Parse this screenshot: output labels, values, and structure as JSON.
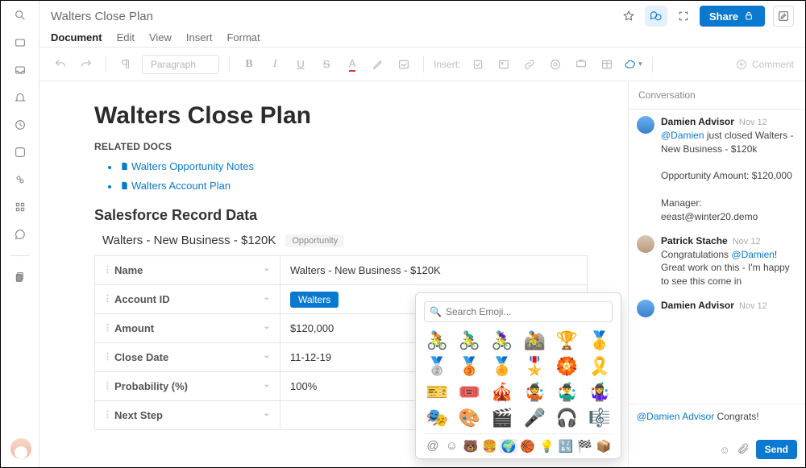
{
  "header": {
    "title": "Walters Close Plan",
    "share_label": "Share",
    "menu": {
      "document": "Document",
      "edit": "Edit",
      "view": "View",
      "insert": "Insert",
      "format": "Format"
    }
  },
  "toolbar": {
    "paragraph_label": "Paragraph",
    "insert_label": "Insert:",
    "comment_label": "Comment"
  },
  "document": {
    "heading": "Walters Close Plan",
    "related_label": "RELATED DOCS",
    "related_docs": [
      {
        "label": "Walters Opportunity Notes"
      },
      {
        "label": "Walters  Account Plan"
      }
    ],
    "salesforce_heading": "Salesforce Record Data",
    "record_title": "Walters - New Business - $120K",
    "record_badge": "Opportunity",
    "table": {
      "rows": [
        {
          "key": "Name",
          "value": "Walters - New Business - $120K",
          "pill": false
        },
        {
          "key": "Account ID",
          "value": "Walters",
          "pill": true
        },
        {
          "key": "Amount",
          "value": "$120,000",
          "pill": false
        },
        {
          "key": "Close Date",
          "value": "11-12-19",
          "pill": false
        },
        {
          "key": "Probability (%)",
          "value": "100%",
          "pill": false
        },
        {
          "key": "Next Step",
          "value": "",
          "pill": false
        }
      ]
    }
  },
  "conversation": {
    "header": "Conversation",
    "messages": [
      {
        "author": "Damien Advisor",
        "date": "Nov 12",
        "avatar": "blue",
        "body": "<span class='mention'>@Damien</span> just closed Walters - New Business - $120k<br><br>Opportunity Amount: $120,000<br><br>Manager: eeast@winter20.demo"
      },
      {
        "author": "Patrick Stache",
        "date": "Nov 12",
        "avatar": "pat",
        "body": "Congratulations <span class='mention'>@Damien</span>! Great work on this - I'm happy to see this come in"
      },
      {
        "author": "Damien Advisor",
        "date": "Nov 12",
        "avatar": "blue",
        "body": ""
      }
    ],
    "compose": {
      "draft_html": "<span class='mention'>@Damien Advisor</span> Congrats!",
      "send_label": "Send"
    }
  },
  "emoji_picker": {
    "search_placeholder": "Search Emoji...",
    "emojis": [
      "🚴",
      "🚴‍♂️",
      "🚴‍♀️",
      "🚵",
      "🏆",
      "🥇",
      "🥈",
      "🥉",
      "🏅",
      "🎖️",
      "🏵️",
      "🎗️",
      "🎫",
      "🎟️",
      "🎪",
      "🤹",
      "🤹‍♂️",
      "🤹‍♀️",
      "🎭",
      "🎨",
      "🎬",
      "🎤",
      "🎧",
      "🎼"
    ],
    "categories": [
      "@",
      "☺",
      "🐻",
      "🍔",
      "🌍",
      "🏀",
      "💡",
      "🔣",
      "🏁",
      "📦"
    ],
    "active_cat_index": 4
  }
}
